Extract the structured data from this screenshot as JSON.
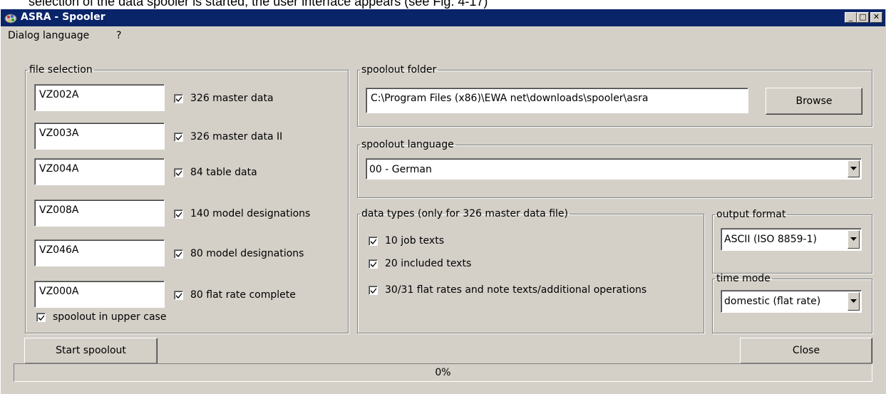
{
  "background_caption": "selection of the data spooler is started, the user interface appears (see Fig. 4-17)",
  "window": {
    "title": "ASRA - Spooler",
    "app_icon": "asra-app-icon",
    "minimize": "_",
    "maximize": "□",
    "close": "✕"
  },
  "menu": {
    "items": [
      "Dialog language",
      "?"
    ]
  },
  "file_selection": {
    "legend": "file selection",
    "files": [
      {
        "name": "VZ002A",
        "label": "326 master data",
        "checked": true
      },
      {
        "name": "VZ003A",
        "label": "326 master data II",
        "checked": true
      },
      {
        "name": "VZ004A",
        "label": "84 table data",
        "checked": true
      },
      {
        "name": "VZ008A",
        "label": "140 model designations",
        "checked": true
      },
      {
        "name": "VZ046A",
        "label": "80 model designations",
        "checked": true
      },
      {
        "name": "VZ000A",
        "label": "80 flat rate complete",
        "checked": true
      }
    ],
    "uppercase": {
      "label": "spoolout in upper case",
      "checked": true
    }
  },
  "spoolout_folder": {
    "legend": "spoolout folder",
    "path": "C:\\Program Files (x86)\\EWA net\\downloads\\spooler\\asra",
    "browse_label": "Browse"
  },
  "spoolout_language": {
    "legend": "spoolout language",
    "selected": "00 - German"
  },
  "data_types": {
    "legend": "data types (only for 326 master data file)",
    "items": [
      {
        "label": "10 job texts",
        "checked": true
      },
      {
        "label": "20 included texts",
        "checked": true
      },
      {
        "label": "30/31 flat rates and note texts/additional operations",
        "checked": true
      }
    ]
  },
  "output_format": {
    "legend": "output format",
    "selected": "ASCII (ISO 8859-1)"
  },
  "time_mode": {
    "legend": "time mode",
    "selected": "domestic (flat rate)"
  },
  "buttons": {
    "start": "Start spoolout",
    "close": "Close"
  },
  "progress": {
    "value": 0,
    "text": "0%"
  }
}
